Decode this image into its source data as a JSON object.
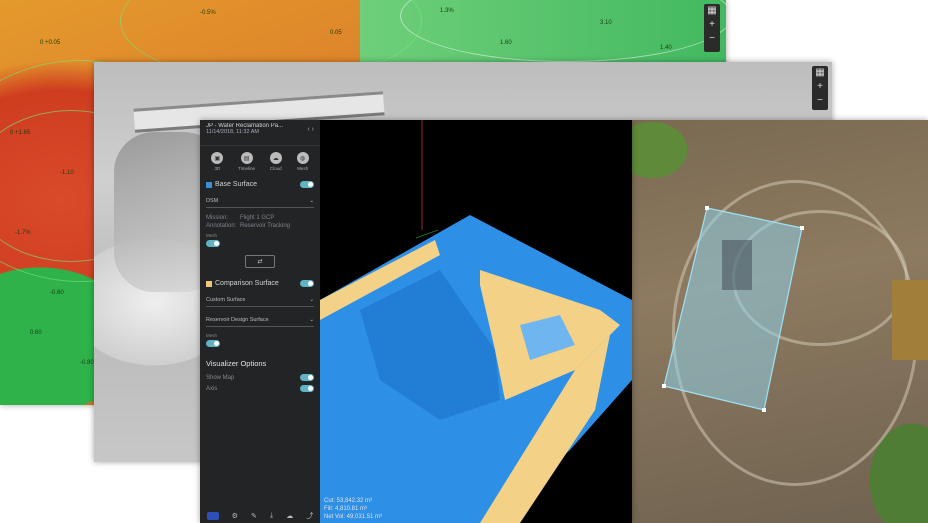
{
  "contour_window": {
    "labels": [
      "0 +0.05",
      "-0.5%",
      "0 +1.65",
      "-1.10",
      "-1.7%",
      "-0.60",
      "0.05",
      "1.60",
      "3.10",
      "1.3%",
      "1.40",
      "0.60",
      "-0.80"
    ]
  },
  "app": {
    "title": "JP - Water Reclamation Pa...",
    "date": "11/14/2018, 11:32 AM",
    "modes": [
      {
        "label": "3D",
        "icon": "cube-icon"
      },
      {
        "label": "Timeline",
        "icon": "timeline-icon"
      },
      {
        "label": "Cloud",
        "icon": "cloud-icon"
      },
      {
        "label": "Mesh",
        "icon": "mesh-icon"
      }
    ],
    "base_surface": {
      "label": "Base Surface",
      "color": "#3a8fd6",
      "select_value": "DSM",
      "mission_key": "Mission:",
      "mission_value": "Flight 1 GCP",
      "annotation_key": "Annotation:",
      "annotation_value": "Reservoir Tracking",
      "toggle_caption": "Mesh"
    },
    "swap_label": "⇄",
    "comparison_surface": {
      "label": "Comparison Surface",
      "color": "#f0c77a",
      "select_value": "Custom Surface",
      "select_value2": "Reservoir Design Surface",
      "toggle_caption": "Mesh"
    },
    "visualizer": {
      "title": "Visualizer Options",
      "options": [
        "Show Map",
        "Axis"
      ]
    },
    "stats": {
      "cut": "Cut: 53,842.32 m³",
      "fill": "Fill: 4,810.81 m³",
      "net": "Net Vol: 49,031.51 m³"
    }
  },
  "colors": {
    "surface_blue": "#2e8fe6",
    "design_yellow": "#f3d288",
    "selection": "#8fcfe6"
  }
}
